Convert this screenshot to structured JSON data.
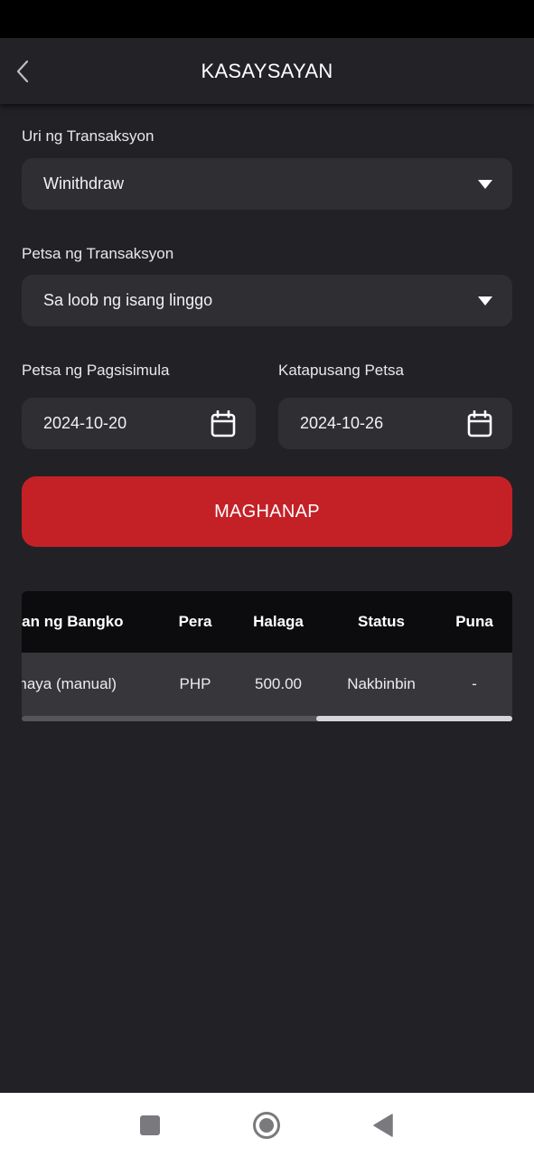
{
  "header": {
    "title": "KASAYSAYAN",
    "back_icon": "chevron-left-icon"
  },
  "form": {
    "type_label": "Uri ng Transaksyon",
    "type_value": "Winithdraw",
    "date_label": "Petsa ng Transaksyon",
    "date_value": "Sa loob ng isang linggo",
    "start_label": "Petsa ng Pagsisimula",
    "start_value": "2024-10-20",
    "end_label": "Katapusang Petsa",
    "end_value": "2024-10-26",
    "search_label": "MAGHANAP"
  },
  "table": {
    "columns": [
      "alan ng Bangko",
      "Pera",
      "Halaga",
      "Status",
      "Puna"
    ],
    "rows": [
      [
        "rmaya (manual)",
        "PHP",
        "500.00",
        "Nakbinbin",
        "-"
      ]
    ],
    "scroll_position": 0.6
  },
  "colors": {
    "background": "#222226",
    "field": "#2e2e33",
    "accent": "#c42127",
    "table_header": "#0c0c0f",
    "table_row": "#36363b"
  },
  "nav": {
    "recents_icon": "square-icon",
    "home_icon": "circle-home-icon",
    "back_icon": "triangle-back-icon"
  }
}
